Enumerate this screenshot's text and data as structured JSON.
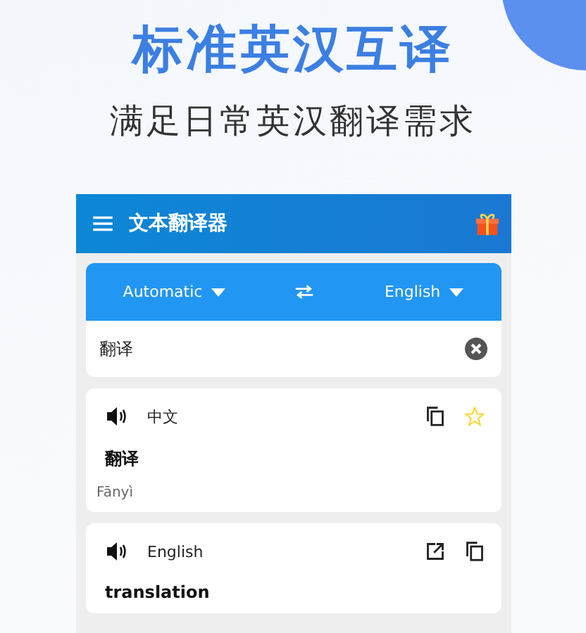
{
  "promo": {
    "title": "标准英汉互译",
    "subtitle": "满足日常英汉翻译需求"
  },
  "app_bar": {
    "title": "文本翻译器"
  },
  "language_bar": {
    "source": "Automatic",
    "target": "English"
  },
  "input": {
    "value": "翻译"
  },
  "results": [
    {
      "kind": "source",
      "language": "中文",
      "text": "翻译",
      "romanization": "Fānyì",
      "starred": false
    },
    {
      "kind": "target",
      "language": "English",
      "text": "translation"
    }
  ]
}
